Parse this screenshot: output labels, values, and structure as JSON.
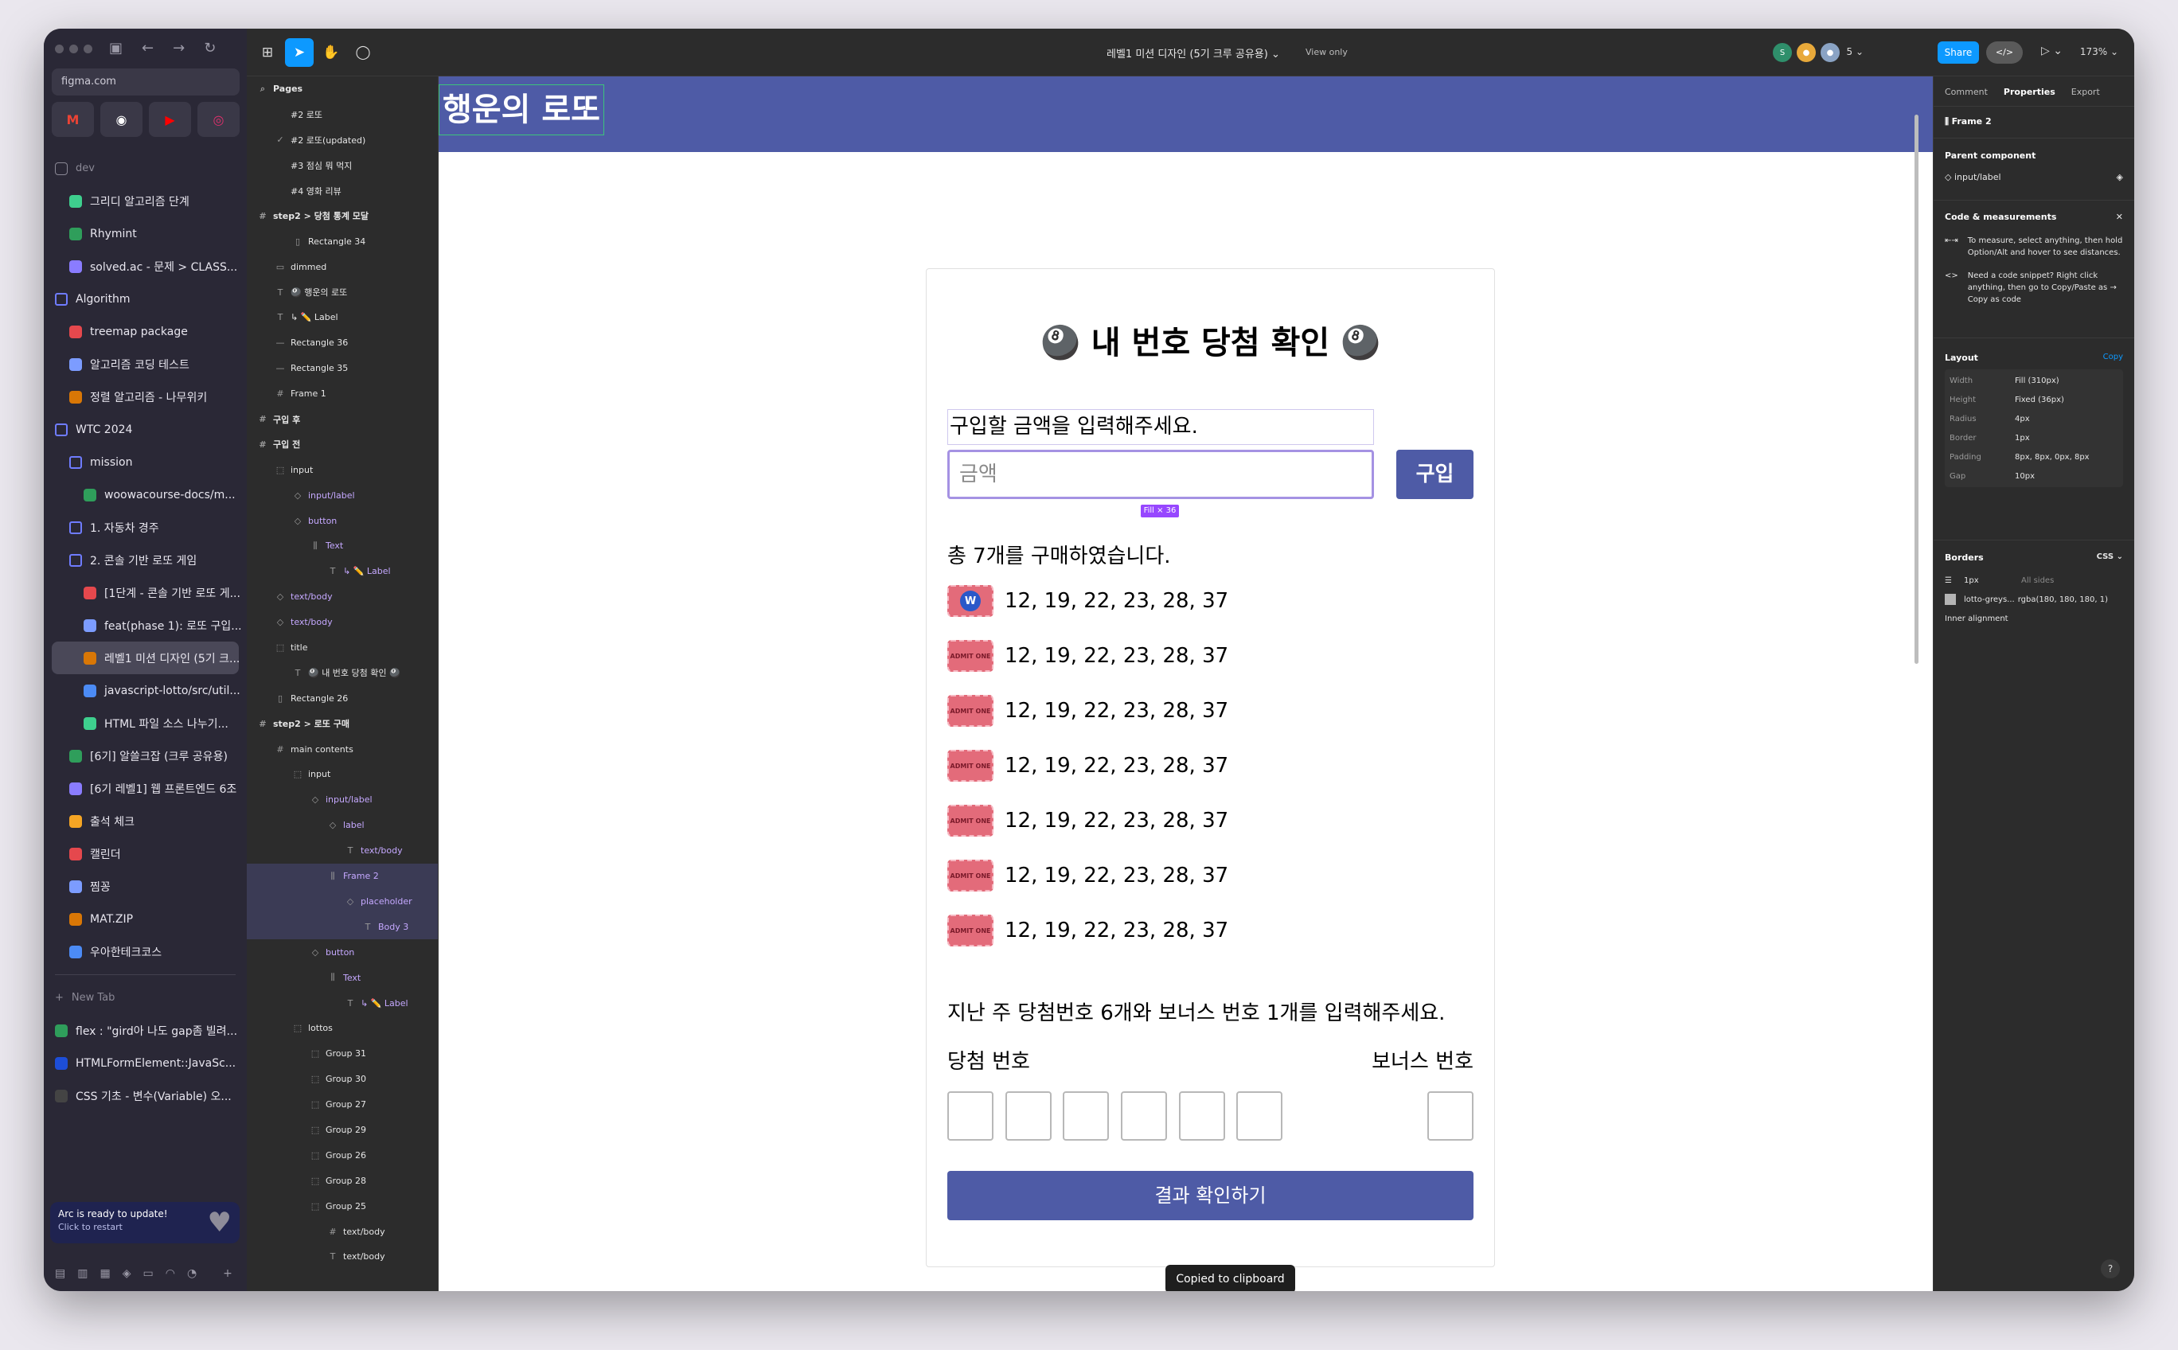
{
  "arc": {
    "url": "figma.com",
    "favorites": [
      "gmail-icon",
      "github-icon",
      "youtube-icon",
      "instagram-icon"
    ],
    "items": [
      {
        "label": "dev",
        "kind": "dim"
      },
      {
        "label": "그리디 알고리즘 단계",
        "indent": 1
      },
      {
        "label": "Rhymint",
        "indent": 1
      },
      {
        "label": "solved.ac - 문제 > CLASS...",
        "indent": 1
      },
      {
        "label": "Algorithm",
        "kind": "folder"
      },
      {
        "label": "treemap package",
        "indent": 1
      },
      {
        "label": "알고리즘 코딩 테스트",
        "indent": 1
      },
      {
        "label": "정렬 알고리즘 - 나무위키",
        "indent": 1
      },
      {
        "label": "WTC 2024",
        "kind": "folder"
      },
      {
        "label": "mission",
        "kind": "folder",
        "indent": 1
      },
      {
        "label": "woowacourse-docs/m...",
        "indent": 2
      },
      {
        "label": "1. 자동차 경주",
        "kind": "folder",
        "indent": 1
      },
      {
        "label": "2. 콘솔 기반 로또 게임",
        "kind": "folder",
        "indent": 1
      },
      {
        "label": "[1단계 - 콘솔 기반 로또 게...",
        "indent": 2
      },
      {
        "label": "feat(phase 1): 로또 구입...",
        "indent": 2
      },
      {
        "label": "레벨1 미션 디자인 (5기 크...",
        "indent": 2,
        "selected": true
      },
      {
        "label": "javascript-lotto/src/util...",
        "indent": 2
      },
      {
        "label": "HTML 파일 소스 나누기...",
        "indent": 2
      },
      {
        "label": "[6기] 알쓸크잡 (크루 공유용)",
        "indent": 1
      },
      {
        "label": "[6기 레벨1] 웹 프론트엔드 6조",
        "indent": 1
      },
      {
        "label": "출석 체크",
        "indent": 1
      },
      {
        "label": "캘린더",
        "indent": 1
      },
      {
        "label": "찜꽁",
        "indent": 1
      },
      {
        "label": "MAT.ZIP",
        "indent": 1
      },
      {
        "label": "우아한테크코스",
        "indent": 1
      }
    ],
    "new_tab": "New Tab",
    "tabs": [
      "flex : \"gird아 나도 gap좀 빌려...",
      "HTMLFormElement::JavaSc...",
      "CSS 기초 - 변수(Variable) 오..."
    ],
    "update_title": "Arc is ready to update!",
    "update_sub": "Click to restart"
  },
  "topbar": {
    "file_title": "레벨1 미션 디자인 (5기 크루 공유용)",
    "view_only": "View only",
    "avatar_initial": "S",
    "avatar_count": "5",
    "share": "Share",
    "zoom": "173%"
  },
  "layers": [
    {
      "label": "Pages",
      "g": "⌕",
      "d": 0,
      "bold": true
    },
    {
      "label": "#2 로또",
      "g": "",
      "d": 1
    },
    {
      "label": "#2 로또(updated)",
      "g": "✓",
      "d": 1
    },
    {
      "label": "#3 점심 뭐 먹지",
      "g": "",
      "d": 1
    },
    {
      "label": "#4 영화 리뷰",
      "g": "",
      "d": 1
    },
    {
      "label": "step2 > 당첨 통계 모달",
      "g": "#",
      "d": 0,
      "bold": true
    },
    {
      "label": "Rectangle 34",
      "g": "▯",
      "d": 2
    },
    {
      "label": "dimmed",
      "g": "▭",
      "d": 1
    },
    {
      "label": "🎱 행운의 로또",
      "g": "T",
      "d": 1
    },
    {
      "label": "↳ ✏️ Label",
      "g": "T",
      "d": 1
    },
    {
      "label": "Rectangle 36",
      "g": "—",
      "d": 1
    },
    {
      "label": "Rectangle 35",
      "g": "—",
      "d": 1
    },
    {
      "label": "Frame 1",
      "g": "#",
      "d": 1
    },
    {
      "label": "구입 후",
      "g": "#",
      "d": 0,
      "bold": true
    },
    {
      "label": "구입 전",
      "g": "#",
      "d": 0,
      "bold": true
    },
    {
      "label": "input",
      "g": "⬚",
      "d": 1
    },
    {
      "label": "input/label",
      "g": "◇",
      "d": 2,
      "comp": true
    },
    {
      "label": "button",
      "g": "◇",
      "d": 2,
      "comp": true
    },
    {
      "label": "Text",
      "g": "⫼",
      "d": 3,
      "comp": true
    },
    {
      "label": "↳ ✏️ Label",
      "g": "T",
      "d": 4,
      "comp": true
    },
    {
      "label": "text/body",
      "g": "◇",
      "d": 1,
      "comp": true
    },
    {
      "label": "text/body",
      "g": "◇",
      "d": 1,
      "comp": true
    },
    {
      "label": "title",
      "g": "⬚",
      "d": 1
    },
    {
      "label": "🎱 내 번호 당첨 확인 🎱",
      "g": "T",
      "d": 2
    },
    {
      "label": "Rectangle 26",
      "g": "▯",
      "d": 1
    },
    {
      "label": "step2 > 로또 구매",
      "g": "#",
      "d": 0,
      "bold": true
    },
    {
      "label": "main contents",
      "g": "#",
      "d": 1
    },
    {
      "label": "input",
      "g": "⬚",
      "d": 2
    },
    {
      "label": "input/label",
      "g": "◇",
      "d": 3,
      "comp": true
    },
    {
      "label": "label",
      "g": "◇",
      "d": 4,
      "comp": true
    },
    {
      "label": "text/body",
      "g": "T",
      "d": 5,
      "comp": true
    },
    {
      "label": "Frame 2",
      "g": "⫼",
      "d": 4,
      "comp": true,
      "hl": true
    },
    {
      "label": "placeholder",
      "g": "◇",
      "d": 5,
      "comp": true,
      "hl": true
    },
    {
      "label": "Body 3",
      "g": "T",
      "d": 6,
      "comp": true,
      "hl": true
    },
    {
      "label": "button",
      "g": "◇",
      "d": 3,
      "comp": true
    },
    {
      "label": "Text",
      "g": "⫼",
      "d": 4,
      "comp": true
    },
    {
      "label": "↳ ✏️ Label",
      "g": "T",
      "d": 5,
      "comp": true
    },
    {
      "label": "lottos",
      "g": "⬚",
      "d": 2
    },
    {
      "label": "Group 31",
      "g": "⬚",
      "d": 3
    },
    {
      "label": "Group 30",
      "g": "⬚",
      "d": 3
    },
    {
      "label": "Group 27",
      "g": "⬚",
      "d": 3
    },
    {
      "label": "Group 29",
      "g": "⬚",
      "d": 3
    },
    {
      "label": "Group 26",
      "g": "⬚",
      "d": 3
    },
    {
      "label": "Group 28",
      "g": "⬚",
      "d": 3
    },
    {
      "label": "Group 25",
      "g": "⬚",
      "d": 3
    },
    {
      "label": "text/body",
      "g": "#",
      "d": 4
    },
    {
      "label": "text/body",
      "g": "T",
      "d": 4
    }
  ],
  "canvas": {
    "logo": "행운의 로또",
    "title": "🎱 내 번호 당첨 확인 🎱",
    "input_label": "구입할 금액을 입력해주세요.",
    "input_placeholder": "금액",
    "fill_tag": "Fill × 36",
    "buy_button": "구입",
    "count_text": "총 7개를 구매하였습니다.",
    "tickets": [
      "12, 19, 22, 23, 28, 37",
      "12, 19, 22, 23, 28, 37",
      "12, 19, 22, 23, 28, 37",
      "12, 19, 22, 23, 28, 37",
      "12, 19, 22, 23, 28, 37",
      "12, 19, 22, 23, 28, 37",
      "12, 19, 22, 23, 28, 37"
    ],
    "ticket_badge": "W",
    "ticket_icon_text": "ADMIT ONE",
    "prompt": "지난 주 당첨번호 6개와 보너스 번호 1개를 입력해주세요.",
    "winning_label": "당첨 번호",
    "bonus_label": "보너스 번호",
    "result_button": "결과 확인하기",
    "toast": "Copied to clipboard"
  },
  "props": {
    "tabs": [
      "Comment",
      "Properties",
      "Export"
    ],
    "frame_name": "Frame 2",
    "parent_component_title": "Parent component",
    "parent_component": "input/label",
    "code_title": "Code & measurements",
    "measure_hint": "To measure, select anything, then hold Option/Alt and hover to see distances.",
    "snippet_hint": "Need a code snippet? Right click anything, then go to Copy/Paste as → Copy as code",
    "layout_title": "Layout",
    "copy": "Copy",
    "layout_rows": [
      {
        "k": "Width",
        "v": "Fill (310px)"
      },
      {
        "k": "Height",
        "v": "Fixed (36px)"
      },
      {
        "k": "Radius",
        "v": "4px"
      },
      {
        "k": "Border",
        "v": "1px"
      },
      {
        "k": "Padding",
        "v": "8px, 8px, 0px, 8px"
      },
      {
        "k": "Gap",
        "v": "10px"
      }
    ],
    "borders_title": "Borders",
    "css": "CSS",
    "border_width": "1px",
    "all_sides": "All sides",
    "border_color_name": "lotto-greys...",
    "border_color_value": "rgba(180, 180, 180, 1)",
    "inner_alignment": "Inner alignment",
    "help": "?"
  },
  "colors": {
    "brand": "#4e5ba6",
    "figma_blue": "#0d99ff",
    "component": "#9747ff"
  }
}
